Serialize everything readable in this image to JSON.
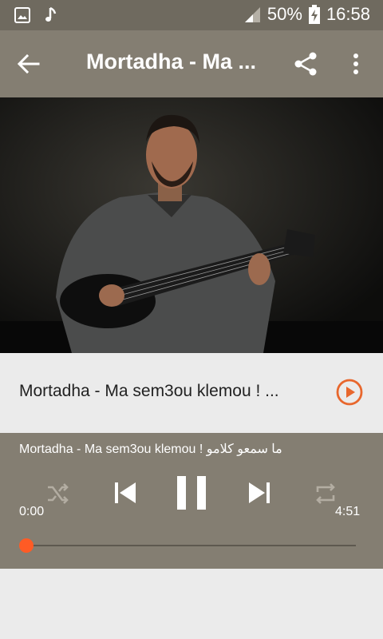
{
  "status": {
    "battery_percent": "50%",
    "time": "16:58"
  },
  "app_bar": {
    "title": "Mortadha - Ma ..."
  },
  "song": {
    "title": "Mortadha - Ma sem3ou klemou ! ..."
  },
  "player": {
    "now_playing": "Mortadha - Ma sem3ou klemou ! ما سمعو كلامو",
    "elapsed": "0:00",
    "duration": "4:51",
    "progress_fraction": 0
  },
  "colors": {
    "status_bar": "#6f6a5f",
    "app_bar": "#847e72",
    "accent": "#ff5b25",
    "background": "#ebebeb"
  },
  "icons": [
    "image-icon",
    "music-note-icon",
    "signal-icon",
    "battery-charging-icon",
    "back-arrow-icon",
    "share-icon",
    "more-vert-icon",
    "play-circle-icon",
    "shuffle-icon",
    "skip-previous-icon",
    "pause-icon",
    "skip-next-icon",
    "repeat-icon"
  ]
}
